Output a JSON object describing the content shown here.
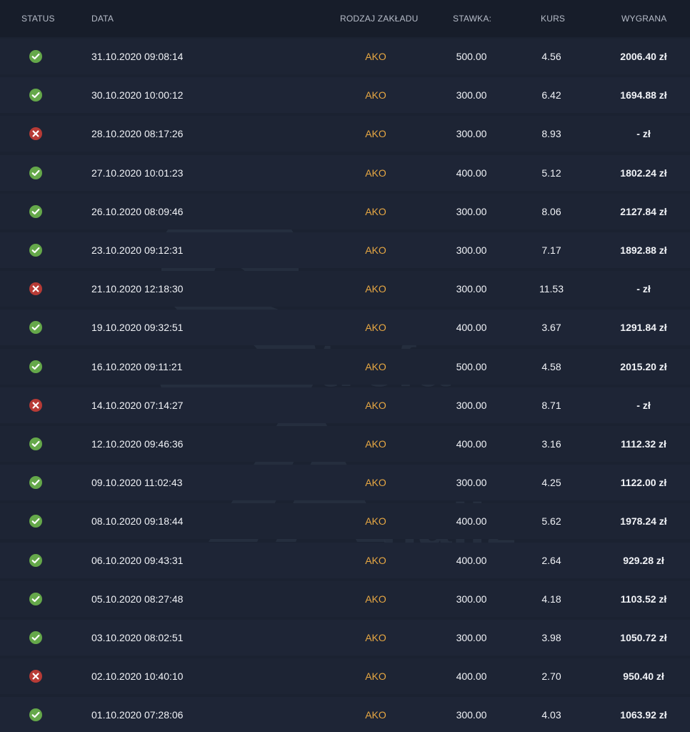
{
  "table": {
    "headers": {
      "status": "STATUS",
      "date": "DATA",
      "type": "RODZAJ ZAKŁADU",
      "stake": "STAWKA:",
      "odds": "KURS",
      "winnings": "WYGRANA"
    },
    "rows": [
      {
        "status": "won",
        "date": "31.10.2020 09:08:14",
        "type": "AKO",
        "stake": "500.00",
        "odds": "4.56",
        "winnings": "2006.40 zł"
      },
      {
        "status": "won",
        "date": "30.10.2020 10:00:12",
        "type": "AKO",
        "stake": "300.00",
        "odds": "6.42",
        "winnings": "1694.88 zł"
      },
      {
        "status": "lost",
        "date": "28.10.2020 08:17:26",
        "type": "AKO",
        "stake": "300.00",
        "odds": "8.93",
        "winnings": "- zł"
      },
      {
        "status": "won",
        "date": "27.10.2020 10:01:23",
        "type": "AKO",
        "stake": "400.00",
        "odds": "5.12",
        "winnings": "1802.24 zł"
      },
      {
        "status": "won",
        "date": "26.10.2020 08:09:46",
        "type": "AKO",
        "stake": "300.00",
        "odds": "8.06",
        "winnings": "2127.84 zł"
      },
      {
        "status": "won",
        "date": "23.10.2020 09:12:31",
        "type": "AKO",
        "stake": "300.00",
        "odds": "7.17",
        "winnings": "1892.88 zł"
      },
      {
        "status": "lost",
        "date": "21.10.2020 12:18:30",
        "type": "AKO",
        "stake": "300.00",
        "odds": "11.53",
        "winnings": "- zł"
      },
      {
        "status": "won",
        "date": "19.10.2020 09:32:51",
        "type": "AKO",
        "stake": "400.00",
        "odds": "3.67",
        "winnings": "1291.84 zł"
      },
      {
        "status": "won",
        "date": "16.10.2020 09:11:21",
        "type": "AKO",
        "stake": "500.00",
        "odds": "4.58",
        "winnings": "2015.20 zł"
      },
      {
        "status": "lost",
        "date": "14.10.2020 07:14:27",
        "type": "AKO",
        "stake": "300.00",
        "odds": "8.71",
        "winnings": "- zł"
      },
      {
        "status": "won",
        "date": "12.10.2020 09:46:36",
        "type": "AKO",
        "stake": "400.00",
        "odds": "3.16",
        "winnings": "1112.32 zł"
      },
      {
        "status": "won",
        "date": "09.10.2020 11:02:43",
        "type": "AKO",
        "stake": "300.00",
        "odds": "4.25",
        "winnings": "1122.00 zł"
      },
      {
        "status": "won",
        "date": "08.10.2020 09:18:44",
        "type": "AKO",
        "stake": "400.00",
        "odds": "5.62",
        "winnings": "1978.24 zł"
      },
      {
        "status": "won",
        "date": "06.10.2020 09:43:31",
        "type": "AKO",
        "stake": "400.00",
        "odds": "2.64",
        "winnings": "929.28 zł"
      },
      {
        "status": "won",
        "date": "05.10.2020 08:27:48",
        "type": "AKO",
        "stake": "300.00",
        "odds": "4.18",
        "winnings": "1103.52 zł"
      },
      {
        "status": "won",
        "date": "03.10.2020 08:02:51",
        "type": "AKO",
        "stake": "300.00",
        "odds": "3.98",
        "winnings": "1050.72 zł"
      },
      {
        "status": "lost",
        "date": "02.10.2020 10:40:10",
        "type": "AKO",
        "stake": "400.00",
        "odds": "2.70",
        "winnings": "950.40 zł"
      },
      {
        "status": "won",
        "date": "01.10.2020 07:28:06",
        "type": "AKO",
        "stake": "300.00",
        "odds": "4.03",
        "winnings": "1063.92 zł"
      }
    ]
  },
  "watermark": {
    "word_1": "trefa",
    "word_2": "naliz"
  },
  "icons": {
    "won": "check-circle-icon",
    "lost": "x-circle-icon"
  },
  "colors": {
    "background": "#1b2231",
    "row_divider": "#161b27",
    "bet_type": "#e8a843",
    "won": "#65a84a",
    "lost": "#b73b36"
  }
}
